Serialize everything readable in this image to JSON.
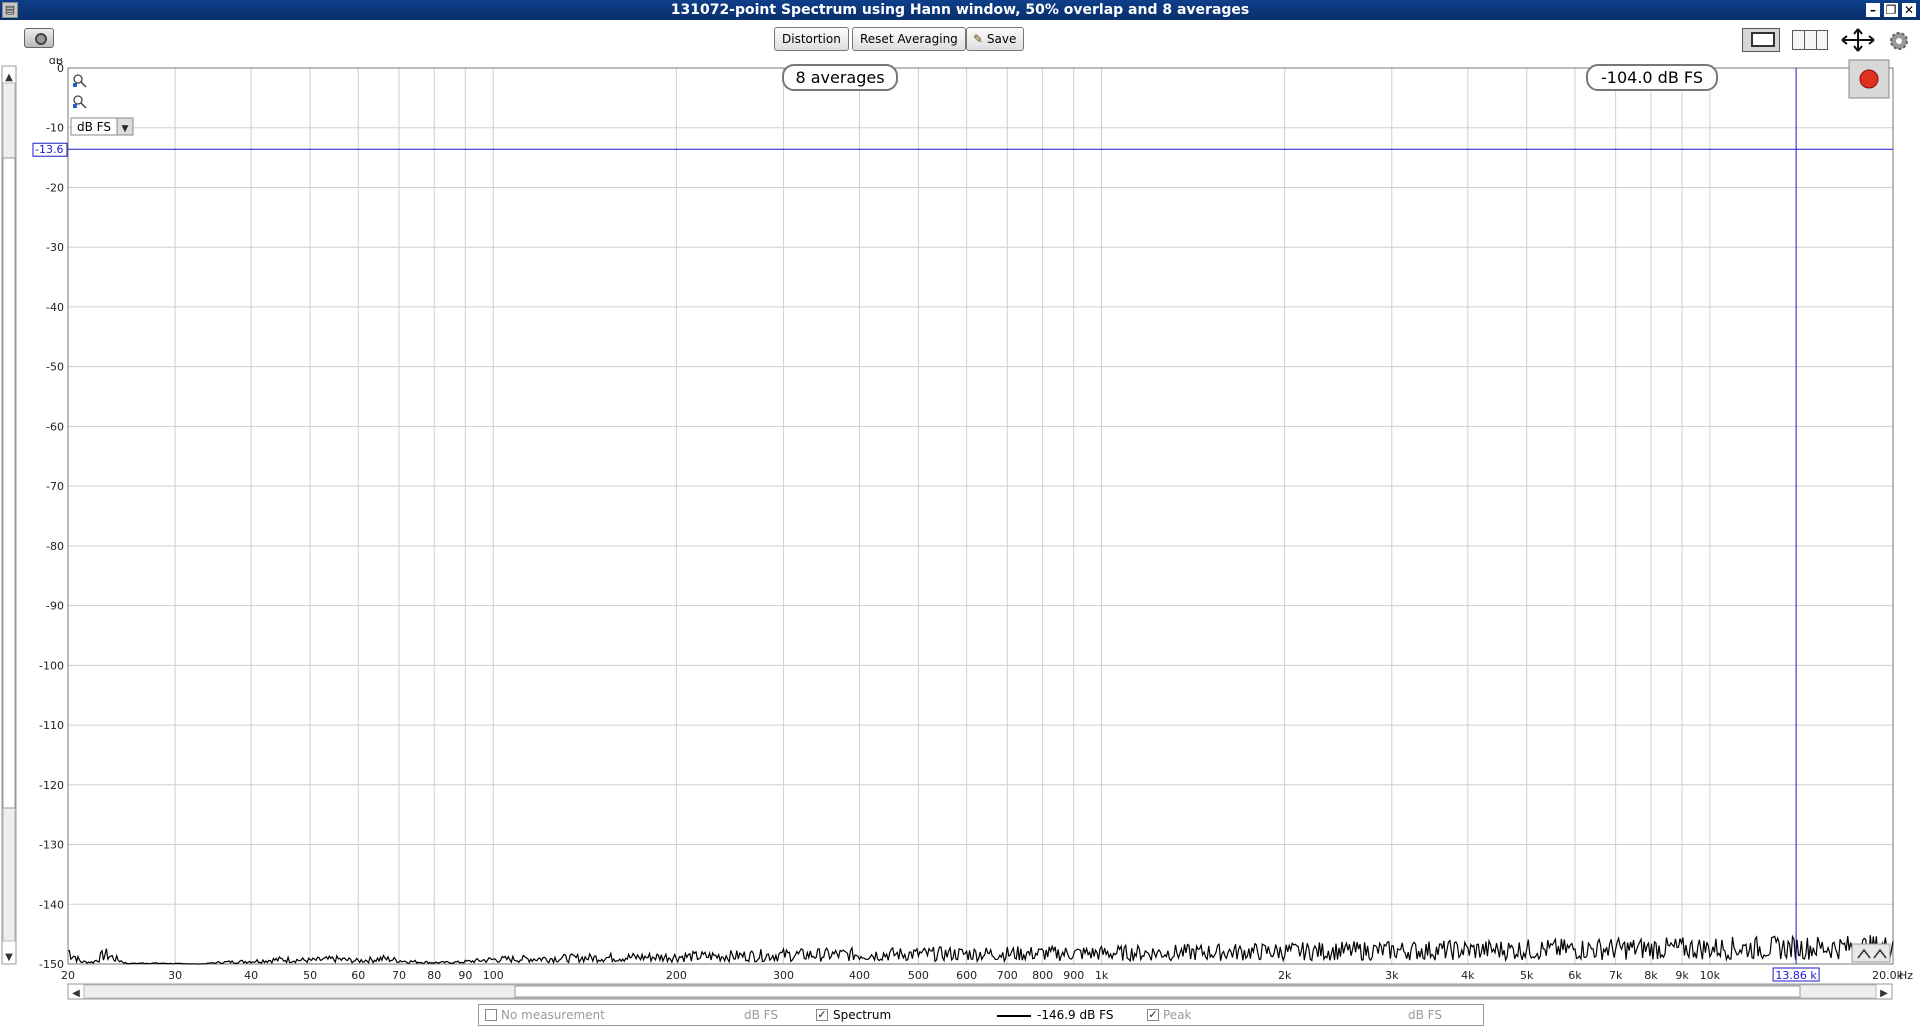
{
  "window": {
    "title": "131072-point Spectrum using Hann window, 50% overlap and 8 averages",
    "app_icon": "▤",
    "minimize": "–",
    "restore": "❐",
    "close": "✕"
  },
  "toolbar": {
    "distortion_label": "Distortion",
    "reset_label": "Reset Averaging",
    "save_label": "Save",
    "save_icon": "✎"
  },
  "plot": {
    "y_unit": "dB",
    "x_unit": "Hz",
    "unit_select": "dB FS",
    "averages_badge": "8 averages",
    "level_badge": "-104.0 dB FS",
    "cursor_y_label": "-13.6",
    "cursor_x_label": "13.86 k",
    "record_color": "#e03020",
    "trace_color": "#000000",
    "cursor_color": "#1a1acc"
  },
  "chart_data": {
    "type": "line",
    "x_scale": "log",
    "xlim": [
      20,
      20000
    ],
    "ylim": [
      -150,
      0
    ],
    "y_ticks": [
      0,
      -10,
      -20,
      -30,
      -40,
      -50,
      -60,
      -70,
      -80,
      -90,
      -100,
      -110,
      -120,
      -130,
      -140,
      -150
    ],
    "x_ticks": [
      {
        "v": 20,
        "label": "20"
      },
      {
        "v": 30,
        "label": "30"
      },
      {
        "v": 40,
        "label": "40"
      },
      {
        "v": 50,
        "label": "50"
      },
      {
        "v": 60,
        "label": "60"
      },
      {
        "v": 70,
        "label": "70"
      },
      {
        "v": 80,
        "label": "80"
      },
      {
        "v": 90,
        "label": "90"
      },
      {
        "v": 100,
        "label": "100"
      },
      {
        "v": 200,
        "label": "200"
      },
      {
        "v": 300,
        "label": "300"
      },
      {
        "v": 400,
        "label": "400"
      },
      {
        "v": 500,
        "label": "500"
      },
      {
        "v": 600,
        "label": "600"
      },
      {
        "v": 700,
        "label": "700"
      },
      {
        "v": 800,
        "label": "800"
      },
      {
        "v": 900,
        "label": "900"
      },
      {
        "v": 1000,
        "label": "1k"
      },
      {
        "v": 2000,
        "label": "2k"
      },
      {
        "v": 3000,
        "label": "3k"
      },
      {
        "v": 4000,
        "label": "4k"
      },
      {
        "v": 5000,
        "label": "5k"
      },
      {
        "v": 6000,
        "label": "6k"
      },
      {
        "v": 7000,
        "label": "7k"
      },
      {
        "v": 8000,
        "label": "8k"
      },
      {
        "v": 9000,
        "label": "9k"
      },
      {
        "v": 10000,
        "label": "10k"
      },
      {
        "v": 20000,
        "label": "20.0k"
      }
    ],
    "grid": true,
    "cursor": {
      "x": 13860,
      "y": -13.6
    },
    "series": [
      {
        "name": "Spectrum",
        "x": [
          20,
          21,
          22,
          23,
          25,
          27,
          30,
          33,
          36,
          40,
          45,
          50,
          55,
          60,
          66,
          72,
          80,
          88,
          100,
          120,
          150,
          200,
          250,
          300,
          400,
          500,
          700,
          1000,
          1500,
          2000,
          3000,
          4000,
          5000,
          7000,
          10000,
          13000,
          16000,
          20000
        ],
        "y": [
          -147.0,
          -149.5,
          -149.6,
          -147.8,
          -149.9,
          -149.8,
          -149.9,
          -150.0,
          -149.6,
          -149.4,
          -149.0,
          -149.2,
          -148.9,
          -149.3,
          -148.8,
          -149.4,
          -149.7,
          -149.6,
          -149.0,
          -148.8,
          -148.6,
          -148.4,
          -148.2,
          -148.0,
          -147.9,
          -147.8,
          -147.7,
          -147.6,
          -147.4,
          -147.2,
          -147.0,
          -146.9,
          -146.8,
          -146.6,
          -146.5,
          -146.4,
          -146.3,
          -146.2
        ]
      }
    ]
  },
  "legend": {
    "item1_label": "No measurement",
    "item1_unit": "dB FS",
    "item2_label": "Spectrum",
    "item2_value": "-146.9 dB FS",
    "item3_label": "Peak",
    "item3_unit": "dB FS",
    "check": "✓"
  }
}
